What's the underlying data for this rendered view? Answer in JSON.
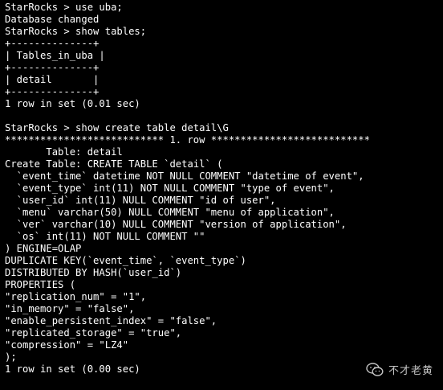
{
  "terminal": {
    "lines": [
      "StarRocks > use uba;",
      "Database changed",
      "StarRocks > show tables;",
      "+--------------+",
      "| Tables_in_uba |",
      "+--------------+",
      "| detail       |",
      "+--------------+",
      "1 row in set (0.01 sec)",
      "",
      "StarRocks > show create table detail\\G",
      "*************************** 1. row ***************************",
      "       Table: detail",
      "Create Table: CREATE TABLE `detail` (",
      "  `event_time` datetime NOT NULL COMMENT \"datetime of event\",",
      "  `event_type` int(11) NOT NULL COMMENT \"type of event\",",
      "  `user_id` int(11) NULL COMMENT \"id of user\",",
      "  `menu` varchar(50) NULL COMMENT \"menu of application\",",
      "  `ver` varchar(10) NULL COMMENT \"version of application\",",
      "  `os` int(11) NOT NULL COMMENT \"\"",
      ") ENGINE=OLAP",
      "DUPLICATE KEY(`event_time`, `event_type`)",
      "DISTRIBUTED BY HASH(`user_id`)",
      "PROPERTIES (",
      "\"replication_num\" = \"1\",",
      "\"in_memory\" = \"false\",",
      "\"enable_persistent_index\" = \"false\",",
      "\"replicated_storage\" = \"true\",",
      "\"compression\" = \"LZ4\"",
      ");",
      "1 row in set (0.00 sec)"
    ]
  },
  "watermark": {
    "icon": "wechat-icon",
    "text": "不才老黄"
  },
  "colors": {
    "background": "#000000",
    "text": "#ffffff"
  }
}
